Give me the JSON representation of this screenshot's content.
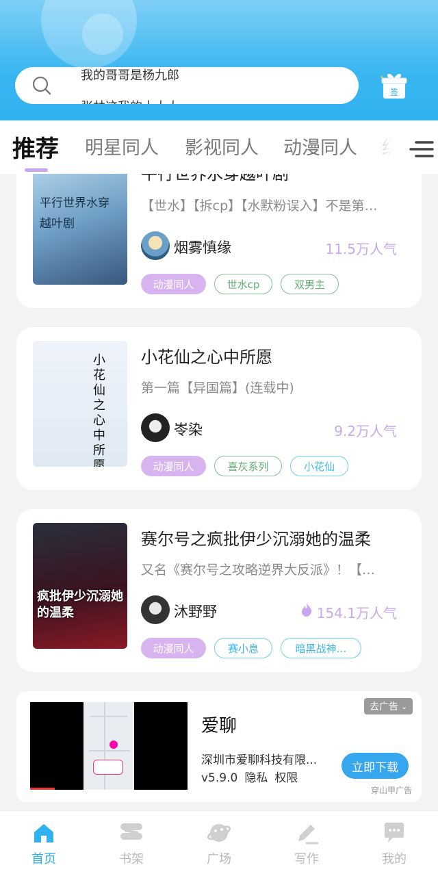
{
  "header": {
    "search_line1": "我的哥哥是杨九郎",
    "search_line2": "张林这我的大大大",
    "sign_label": "签"
  },
  "tabs": [
    {
      "label": "推荐",
      "active": true
    },
    {
      "label": "明星同人"
    },
    {
      "label": "影视同人"
    },
    {
      "label": "动漫同人"
    },
    {
      "label": "综影"
    }
  ],
  "books": [
    {
      "title": "平行世界水穿越叶剧",
      "description": "【世水】【拆cp】【水默粉误入】不是第…",
      "author": "烟雾慎缘",
      "popularity": "11.5万人气",
      "tags": [
        "动漫同人",
        "世水cp",
        "双男主"
      ],
      "cover_text": "平行世界水穿越叶剧"
    },
    {
      "title": "小花仙之心中所愿",
      "description": "第一篇【异国篇】(连载中)",
      "author": "岺染",
      "popularity": "9.2万人气",
      "tags": [
        "动漫同人",
        "喜灰系列",
        "小花仙"
      ],
      "cover_text": "小花仙之心中所愿"
    },
    {
      "title": "赛尔号之疯批伊少沉溺她的温柔",
      "description": "又名《赛尔号之攻略逆界大反派》！【…",
      "author": "沐野野",
      "popularity": "154.1万人气",
      "tags": [
        "动漫同人",
        "赛小息",
        "暗黑战神…"
      ],
      "cover_text": "疯批伊少沉溺她的温柔"
    }
  ],
  "ad": {
    "title": "爱聊",
    "company": "深圳市爱聊科技有限...",
    "version": "v5.9.0",
    "privacy": "隐私",
    "permission": "权限",
    "close_label": "去广告",
    "download_label": "立即下载",
    "source": "穿山甲广告"
  },
  "bottom_nav": [
    {
      "label": "首页",
      "icon": "home-icon",
      "active": true
    },
    {
      "label": "书架",
      "icon": "bookshelf-icon"
    },
    {
      "label": "广场",
      "icon": "planet-icon"
    },
    {
      "label": "写作",
      "icon": "pen-icon"
    },
    {
      "label": "我的",
      "icon": "chat-bubble-icon"
    }
  ],
  "colors": {
    "header_blue": "#2fb2ef",
    "accent_purple": "#c7a8ee",
    "tag_green": "#5fae73",
    "tag_cyan": "#3ab6e5"
  }
}
